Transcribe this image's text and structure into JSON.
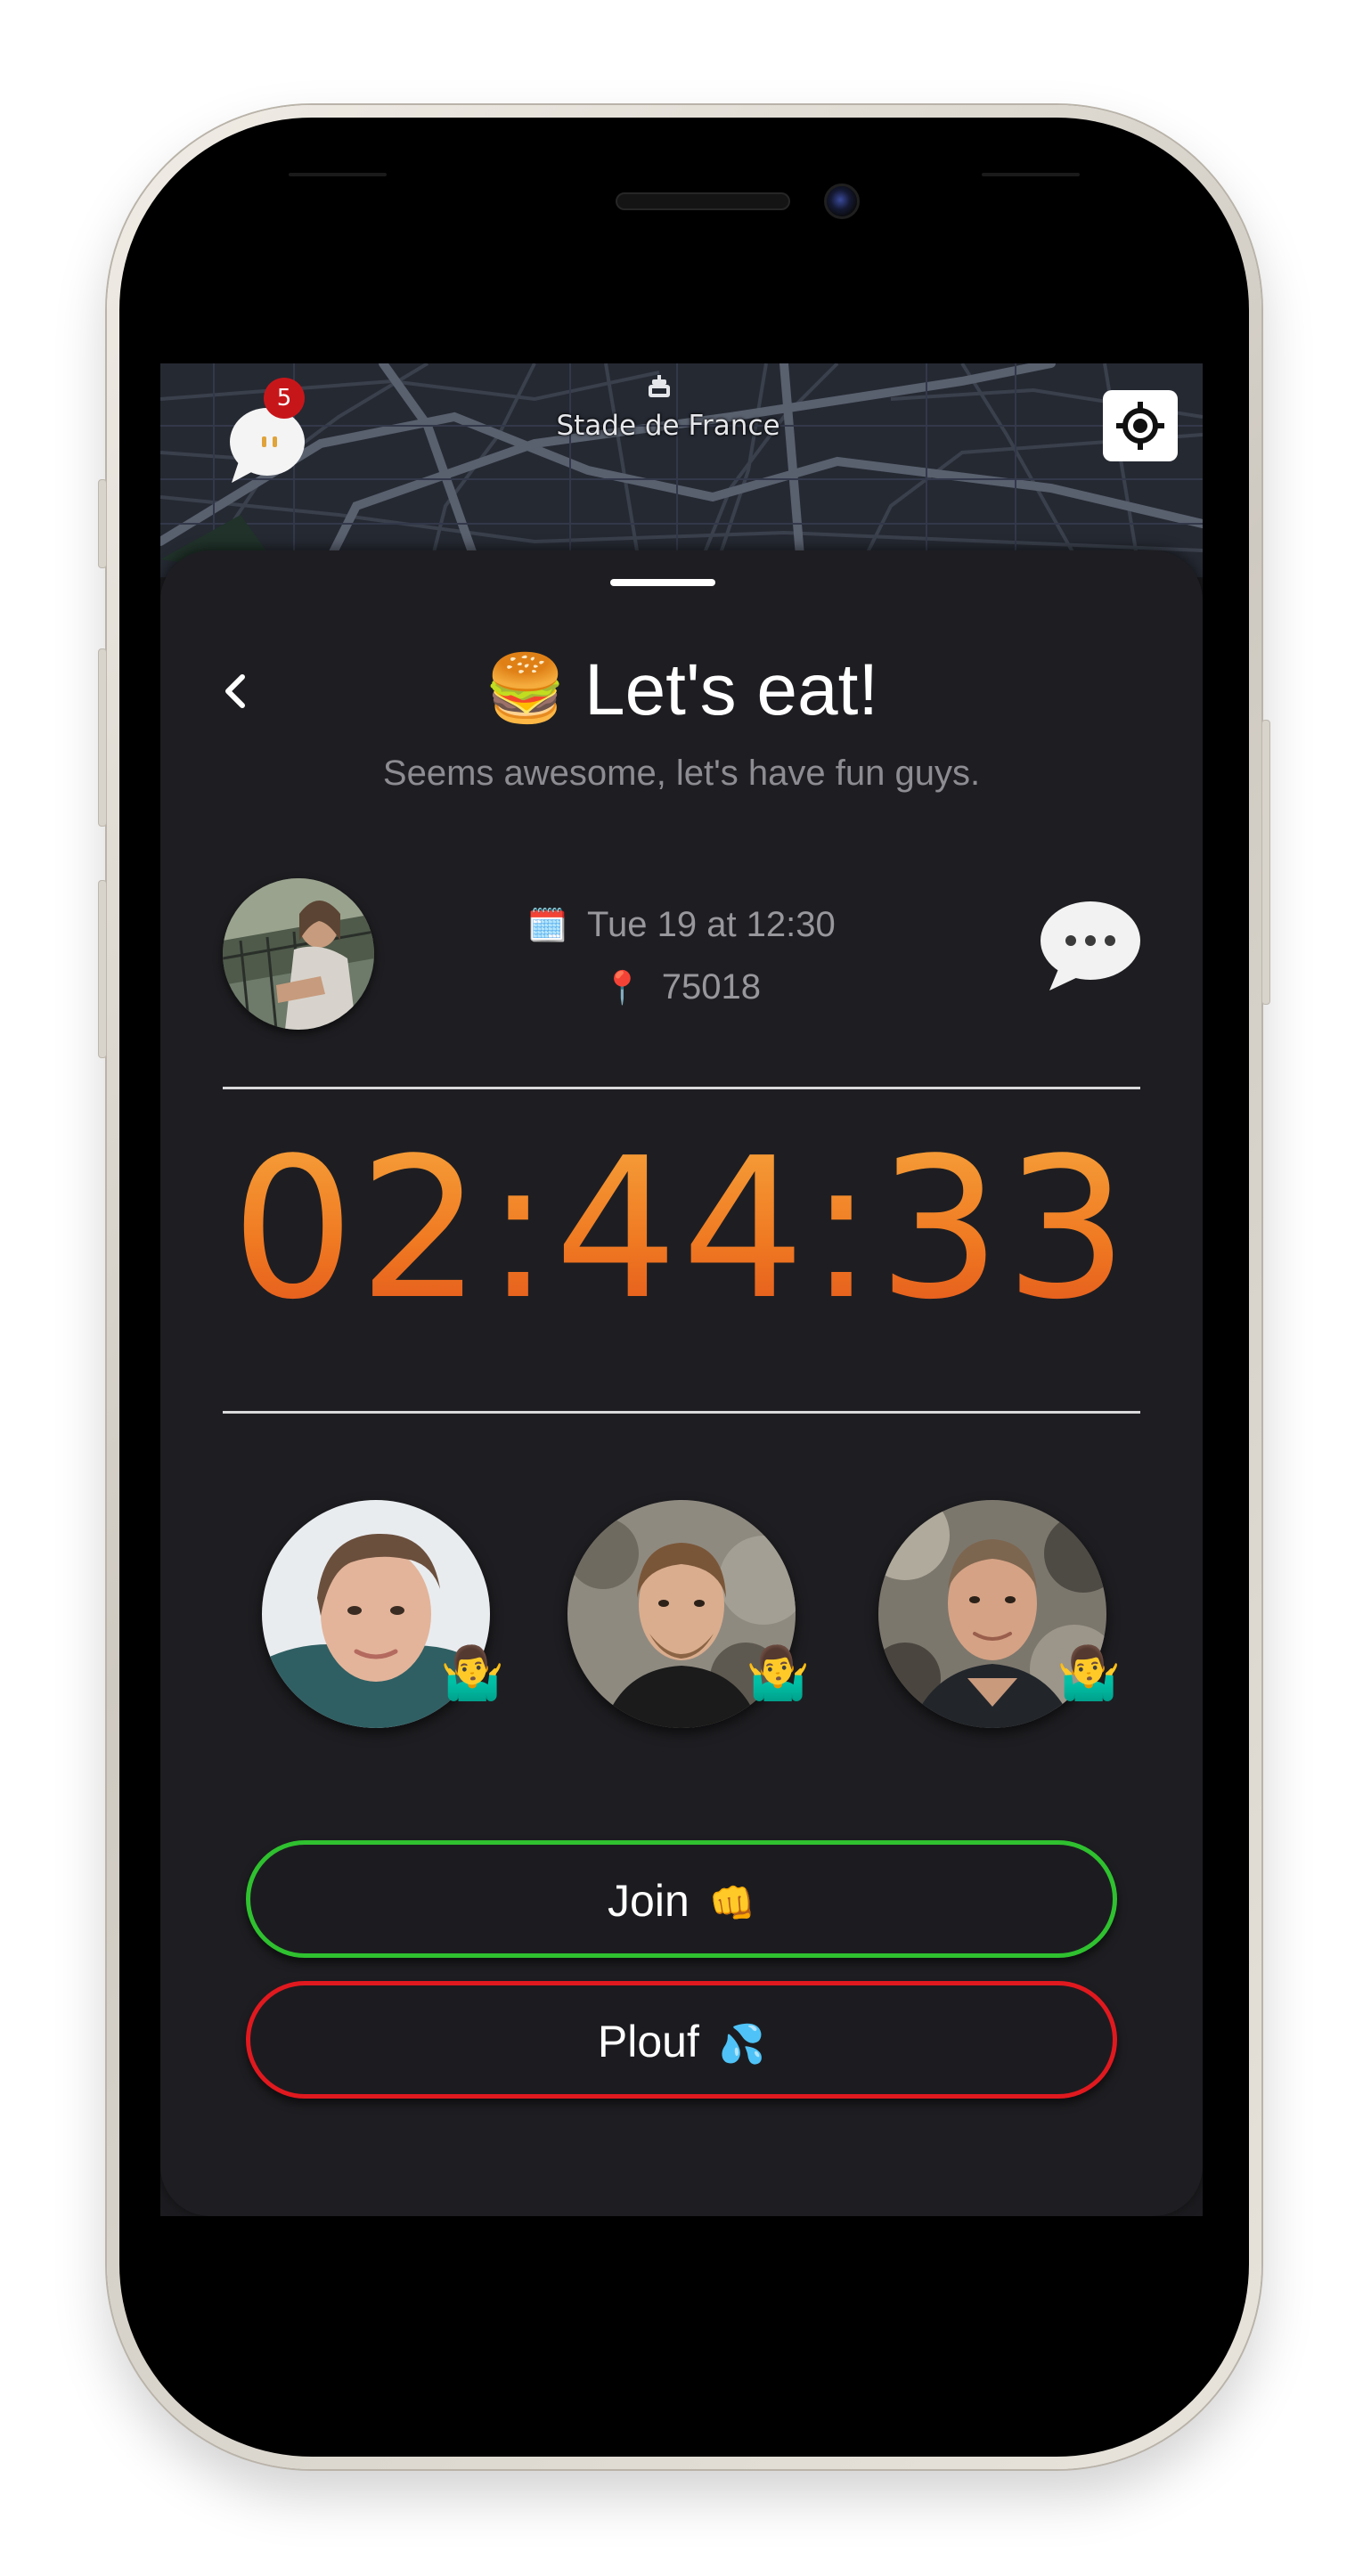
{
  "map": {
    "place_label": "Stade de France",
    "poi_icon": "stadium-icon",
    "chat_badge_count": "5",
    "chat_icon": "speech-bubble-icon",
    "locate_icon": "crosshair-location-icon"
  },
  "event": {
    "title_emoji": "🍔",
    "title": "Let's eat!",
    "subtitle": "Seems awesome, let's have fun guys.",
    "date_icon": "🗓️",
    "date": "Tue 19 at 12:30",
    "location_icon": "📍",
    "location": "75018",
    "countdown": "02:44:33"
  },
  "participants": [
    {
      "status_emoji": "🤷‍♂️"
    },
    {
      "status_emoji": "🤷‍♂️"
    },
    {
      "status_emoji": "🤷‍♂️"
    }
  ],
  "actions": {
    "join_label": "Join",
    "join_emoji": "👊",
    "plouf_label": "Plouf",
    "plouf_emoji": "💦"
  },
  "colors": {
    "join_border": "#2fc12f",
    "plouf_border": "#e0191f",
    "timer_orange": "#f07a22",
    "badge_red": "#c7161a",
    "sheet_background": "#1e1e22"
  }
}
